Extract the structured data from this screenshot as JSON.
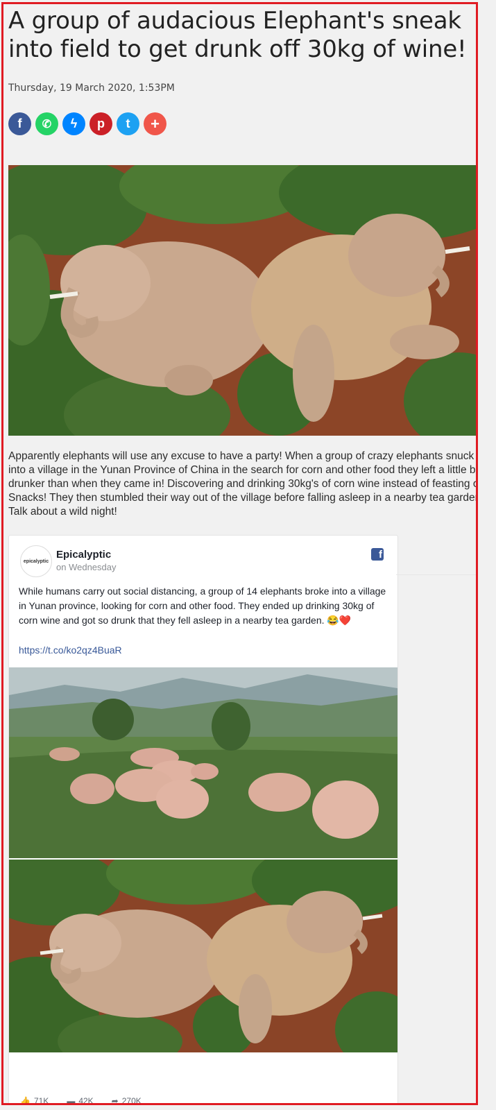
{
  "article": {
    "title": "A group of audacious Elephant's sneak into field to get drunk off 30kg of wine!",
    "date": "Thursday, 19 March 2020, 1:53PM",
    "body": "Apparently elephants will use any excuse to have a party! When a group of crazy elephants snuck into a village in the Yunan Province of China in the search for corn and other food they left a little bit drunker than when they came in! Discovering and drinking 30kg's of corn wine instead of feasting on Snacks! They then stumbled their way out of the village before falling asleep in a nearby tea garden. Talk about a wild night!"
  },
  "share": {
    "buttons": [
      {
        "icon": "facebook-icon",
        "glyph": "f",
        "color": "#3b5998"
      },
      {
        "icon": "whatsapp-icon",
        "glyph": "✆",
        "color": "#25d366"
      },
      {
        "icon": "messenger-icon",
        "glyph": "ϟ",
        "color": "#0084ff"
      },
      {
        "icon": "pinterest-icon",
        "glyph": "p",
        "color": "#cb2027"
      },
      {
        "icon": "twitter-icon",
        "glyph": "t",
        "color": "#1da1f2"
      },
      {
        "icon": "more-icon",
        "glyph": "+",
        "color": "#f0564a"
      }
    ]
  },
  "embed": {
    "avatar_text": "epicalyptic",
    "author": "Epicalyptic",
    "posted": "on Wednesday",
    "text": "While humans carry out social distancing, a group of 14 elephants broke into a village in Yunan province, looking for corn and other food. They ended up drinking 30kg of corn wine and got so drunk that they fell asleep in a nearby tea garden. 😂❤️",
    "link": "https://t.co/ko2qz4BuaR",
    "likes": "71K",
    "comments": "42K",
    "shares": "270K"
  }
}
